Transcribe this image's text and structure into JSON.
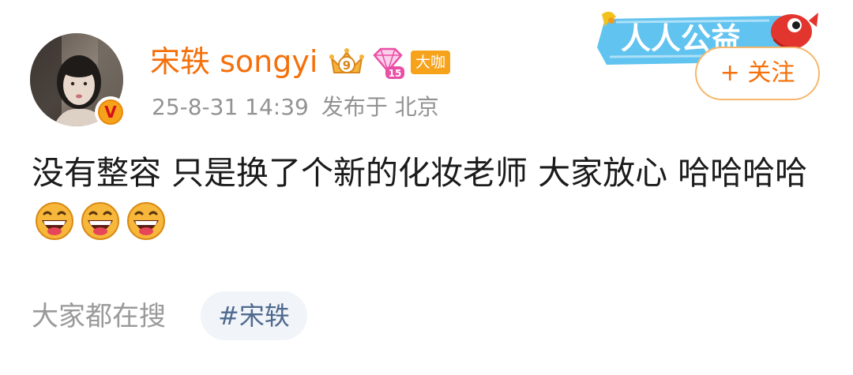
{
  "post": {
    "author": {
      "name": "宋轶 songyi",
      "crown_level": "9",
      "gem_level": "15",
      "badge": "大咖",
      "verified_mark": "V"
    },
    "meta": {
      "time": "25-8-31 14:39",
      "location": "发布于 北京"
    },
    "follow_label": "+ 关注",
    "banner_text": "人人公益",
    "content": {
      "text": "没有整容 只是换了个新的化妆老师 大家放心 哈哈哈哈",
      "emojis": [
        "laughing-emoji",
        "laughing-emoji",
        "laughing-emoji"
      ]
    }
  },
  "search": {
    "label": "大家都在搜",
    "tag": "#宋轶"
  },
  "colors": {
    "accent": "#f5700a",
    "meta_gray": "#939393",
    "tag_bg": "#f1f4f8",
    "tag_text": "#4f6a8f",
    "banner_blue": "#4fb8e8"
  }
}
